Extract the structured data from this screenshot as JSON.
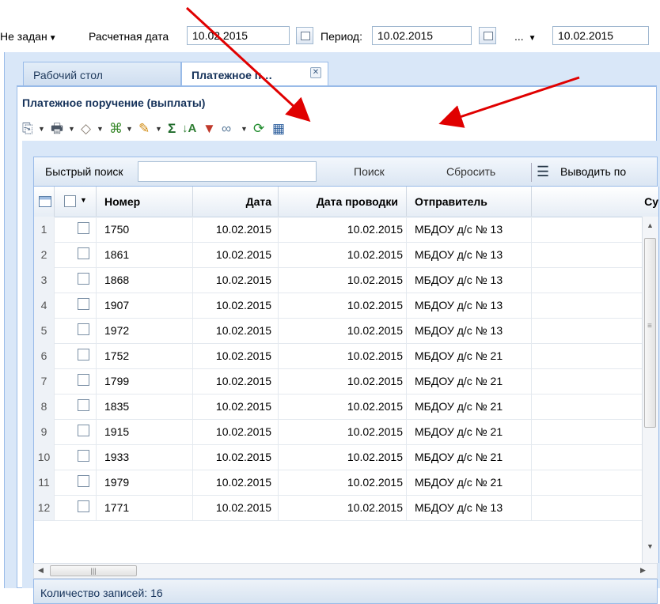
{
  "topbar": {
    "status_prefix": "Не задан",
    "calc_date_label": "Расчетная дата",
    "calc_date_value": "10.02.2015",
    "period_label": "Период:",
    "period_from": "10.02.2015",
    "period_sep": "...",
    "period_to": "10.02.2015"
  },
  "tabs": [
    {
      "label": "Рабочий стол"
    },
    {
      "label": "Платежное п…"
    }
  ],
  "panel_title": "Платежное поручение (выплаты)",
  "search": {
    "label": "Быстрый поиск",
    "value": "",
    "search_button": "Поиск",
    "reset_button": "Сбросить",
    "output_label": "Выводить по"
  },
  "columns": [
    "Номер",
    "Дата",
    "Дата проводки",
    "Отправитель",
    "Су"
  ],
  "rows": [
    {
      "n": "1",
      "num": "1750",
      "date": "10.02.2015",
      "post": "10.02.2015",
      "sender": "МБДОУ д/с № 13"
    },
    {
      "n": "2",
      "num": "1861",
      "date": "10.02.2015",
      "post": "10.02.2015",
      "sender": "МБДОУ д/с № 13"
    },
    {
      "n": "3",
      "num": "1868",
      "date": "10.02.2015",
      "post": "10.02.2015",
      "sender": "МБДОУ д/с № 13"
    },
    {
      "n": "4",
      "num": "1907",
      "date": "10.02.2015",
      "post": "10.02.2015",
      "sender": "МБДОУ д/с № 13"
    },
    {
      "n": "5",
      "num": "1972",
      "date": "10.02.2015",
      "post": "10.02.2015",
      "sender": "МБДОУ д/с № 13"
    },
    {
      "n": "6",
      "num": "1752",
      "date": "10.02.2015",
      "post": "10.02.2015",
      "sender": "МБДОУ д/с № 21"
    },
    {
      "n": "7",
      "num": "1799",
      "date": "10.02.2015",
      "post": "10.02.2015",
      "sender": "МБДОУ д/с № 21"
    },
    {
      "n": "8",
      "num": "1835",
      "date": "10.02.2015",
      "post": "10.02.2015",
      "sender": "МБДОУ д/с № 21"
    },
    {
      "n": "9",
      "num": "1915",
      "date": "10.02.2015",
      "post": "10.02.2015",
      "sender": "МБДОУ д/с № 21"
    },
    {
      "n": "10",
      "num": "1933",
      "date": "10.02.2015",
      "post": "10.02.2015",
      "sender": "МБДОУ д/с № 21"
    },
    {
      "n": "11",
      "num": "1979",
      "date": "10.02.2015",
      "post": "10.02.2015",
      "sender": "МБДОУ д/с № 21"
    },
    {
      "n": "12",
      "num": "1771",
      "date": "10.02.2015",
      "post": "10.02.2015",
      "sender": "МБДОУ д/с № 13"
    }
  ],
  "status": "Количество записей: 16",
  "icons": [
    "copy-icon",
    "print-icon",
    "eraser-icon",
    "paste-icon",
    "edit-icon",
    "sum-icon",
    "sort-icon",
    "filter-icon",
    "link-icon",
    "refresh-icon",
    "columns-icon"
  ],
  "colors": {
    "arrow": "#e00000",
    "panel_bg": "#d9e7f8",
    "border": "#99bbe8"
  }
}
